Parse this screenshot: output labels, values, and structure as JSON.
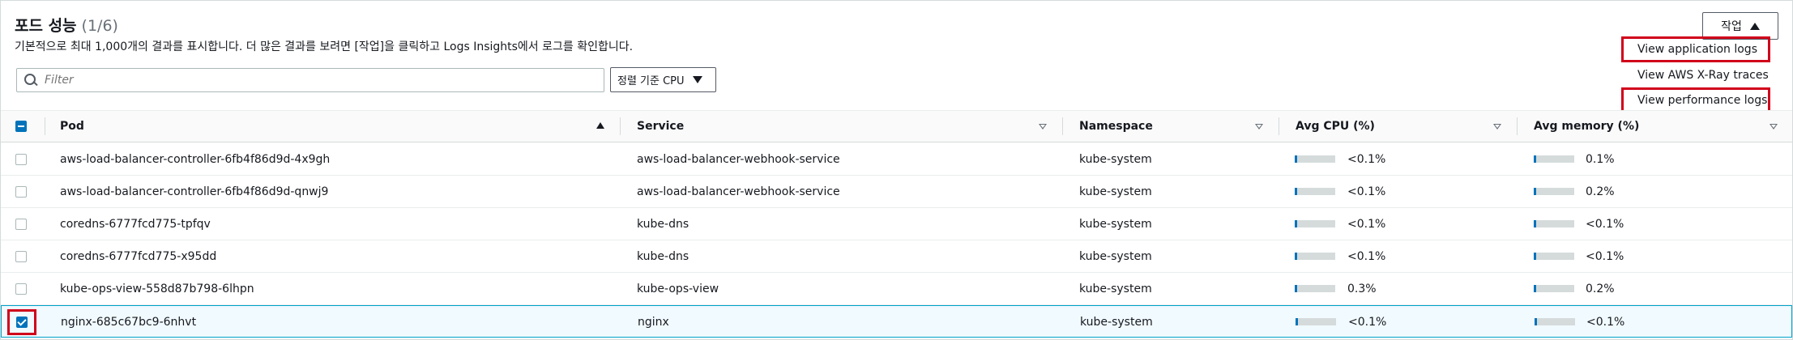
{
  "header": {
    "title": "포드 성능",
    "count": "(1/6)",
    "description": "기본적으로 최대 1,000개의 결과를 표시합니다. 더 많은 결과를 보려면 [작업]을 클릭하고 Logs Insights에서 로그를 확인합니다.",
    "action_label": "작업"
  },
  "actions_menu": {
    "items": [
      {
        "label": "View application logs",
        "highlighted": true
      },
      {
        "label": "View AWS X-Ray traces",
        "highlighted": false
      },
      {
        "label": "View performance logs",
        "highlighted": true
      }
    ]
  },
  "filter": {
    "placeholder": "Filter",
    "value": ""
  },
  "sort": {
    "label": "정렬 기준 CPU"
  },
  "table": {
    "columns": [
      "Pod",
      "Service",
      "Namespace",
      "Avg CPU (%)",
      "Avg memory (%)"
    ],
    "rows": [
      {
        "pod": "aws-load-balancer-controller-6fb4f86d9d-4x9gh",
        "service": "aws-load-balancer-webhook-service",
        "namespace": "kube-system",
        "cpu": "<0.1%",
        "cpu_level": 0.02,
        "memory": "0.1%",
        "memory_level": 0.02,
        "checked": false
      },
      {
        "pod": "aws-load-balancer-controller-6fb4f86d9d-qnwj9",
        "service": "aws-load-balancer-webhook-service",
        "namespace": "kube-system",
        "cpu": "<0.1%",
        "cpu_level": 0.02,
        "memory": "0.2%",
        "memory_level": 0.02,
        "checked": false
      },
      {
        "pod": "coredns-6777fcd775-tpfqv",
        "service": "kube-dns",
        "namespace": "kube-system",
        "cpu": "<0.1%",
        "cpu_level": 0.02,
        "memory": "<0.1%",
        "memory_level": 0.02,
        "checked": false
      },
      {
        "pod": "coredns-6777fcd775-x95dd",
        "service": "kube-dns",
        "namespace": "kube-system",
        "cpu": "<0.1%",
        "cpu_level": 0.02,
        "memory": "<0.1%",
        "memory_level": 0.02,
        "checked": false
      },
      {
        "pod": "kube-ops-view-558d87b798-6lhpn",
        "service": "kube-ops-view",
        "namespace": "kube-system",
        "cpu": "0.3%",
        "cpu_level": 0.03,
        "memory": "0.2%",
        "memory_level": 0.02,
        "checked": false
      },
      {
        "pod": "nginx-685c67bc9-6nhvt",
        "service": "nginx",
        "namespace": "kube-system",
        "cpu": "<0.1%",
        "cpu_level": 0.02,
        "memory": "<0.1%",
        "memory_level": 0.02,
        "checked": true
      }
    ]
  },
  "colors": {
    "accent": "#0073bb",
    "highlight": "#d0021b",
    "selected_row_bg": "#f1faff",
    "selected_row_border": "#00a1c9"
  }
}
